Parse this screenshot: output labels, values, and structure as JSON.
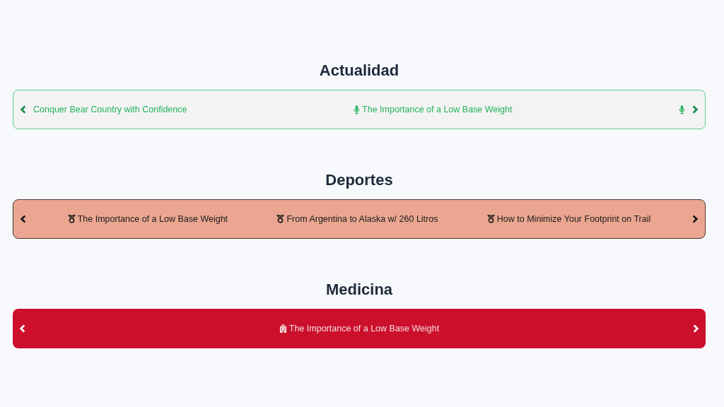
{
  "tickers": [
    {
      "title": "Actualidad",
      "items": [
        {
          "kind": "text",
          "text": "Conquer Bear Country with Confidence"
        },
        {
          "kind": "icon-text",
          "text": "The Importance of a Low Base Weight"
        },
        {
          "kind": "icon"
        }
      ]
    },
    {
      "title": "Deportes",
      "items": [
        {
          "kind": "icon-text",
          "text": "The Importance of a Low Base Weight"
        },
        {
          "kind": "icon-text",
          "text": "From Argentina to Alaska w/ 260 Litros"
        },
        {
          "kind": "icon-text",
          "text": "How to Minimize Your Footprint on Trail"
        }
      ]
    },
    {
      "title": "Medicina",
      "items": [
        {
          "kind": "icon-text",
          "text": "The Importance of a Low Base Weight"
        }
      ]
    }
  ]
}
